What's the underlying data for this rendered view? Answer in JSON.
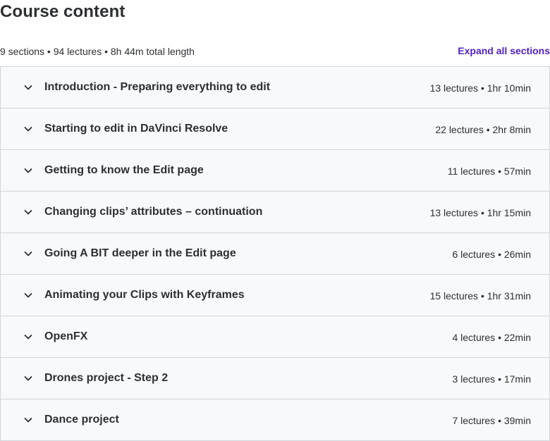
{
  "heading": "Course content",
  "summary": "9 sections • 94 lectures • 8h 44m total length",
  "expand_label": "Expand all sections",
  "sections": [
    {
      "title": "Introduction - Preparing everything to edit",
      "info": "13 lectures • 1hr 10min"
    },
    {
      "title": "Starting to edit in DaVinci Resolve",
      "info": "22 lectures • 2hr 8min"
    },
    {
      "title": "Getting to know the Edit page",
      "info": "11 lectures • 57min"
    },
    {
      "title": "Changing clips’ attributes – continuation",
      "info": "13 lectures • 1hr 15min"
    },
    {
      "title": "Going A BIT deeper in the Edit page",
      "info": "6 lectures • 26min"
    },
    {
      "title": "Animating your Clips with Keyframes",
      "info": "15 lectures • 1hr 31min"
    },
    {
      "title": "OpenFX",
      "info": "4 lectures • 22min"
    },
    {
      "title": "Drones project - Step 2",
      "info": "3 lectures • 17min"
    },
    {
      "title": "Dance project",
      "info": "7 lectures • 39min"
    }
  ],
  "icons": {
    "section_toggle": "chevron-down-icon"
  },
  "colors": {
    "accent": "#5022c3",
    "text": "#2d2f31",
    "row_bg": "#f7f9fa",
    "border": "#d1d7dc"
  }
}
